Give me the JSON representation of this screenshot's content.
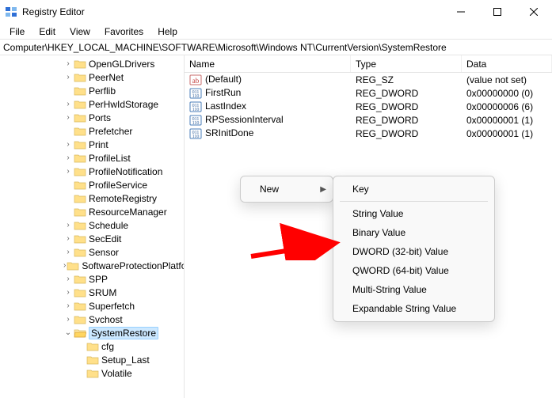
{
  "window": {
    "title": "Registry Editor"
  },
  "menus": {
    "file": "File",
    "edit": "Edit",
    "view": "View",
    "favorites": "Favorites",
    "help": "Help"
  },
  "address": "Computer\\HKEY_LOCAL_MACHINE\\SOFTWARE\\Microsoft\\Windows NT\\CurrentVersion\\SystemRestore",
  "columns": {
    "name": "Name",
    "type": "Type",
    "data": "Data"
  },
  "values": [
    {
      "icon": "string",
      "name": "(Default)",
      "type": "REG_SZ",
      "data": "(value not set)"
    },
    {
      "icon": "binary",
      "name": "FirstRun",
      "type": "REG_DWORD",
      "data": "0x00000000 (0)"
    },
    {
      "icon": "binary",
      "name": "LastIndex",
      "type": "REG_DWORD",
      "data": "0x00000006 (6)"
    },
    {
      "icon": "binary",
      "name": "RPSessionInterval",
      "type": "REG_DWORD",
      "data": "0x00000001 (1)"
    },
    {
      "icon": "binary",
      "name": "SRInitDone",
      "type": "REG_DWORD",
      "data": "0x00000001 (1)"
    }
  ],
  "tree": [
    {
      "indent": 5,
      "exp": ">",
      "label": "OpenGLDrivers"
    },
    {
      "indent": 5,
      "exp": ">",
      "label": "PeerNet"
    },
    {
      "indent": 5,
      "exp": "",
      "label": "Perflib"
    },
    {
      "indent": 5,
      "exp": ">",
      "label": "PerHwIdStorage"
    },
    {
      "indent": 5,
      "exp": ">",
      "label": "Ports"
    },
    {
      "indent": 5,
      "exp": "",
      "label": "Prefetcher"
    },
    {
      "indent": 5,
      "exp": ">",
      "label": "Print"
    },
    {
      "indent": 5,
      "exp": ">",
      "label": "ProfileList"
    },
    {
      "indent": 5,
      "exp": ">",
      "label": "ProfileNotification"
    },
    {
      "indent": 5,
      "exp": "",
      "label": "ProfileService"
    },
    {
      "indent": 5,
      "exp": "",
      "label": "RemoteRegistry"
    },
    {
      "indent": 5,
      "exp": "",
      "label": "ResourceManager"
    },
    {
      "indent": 5,
      "exp": ">",
      "label": "Schedule"
    },
    {
      "indent": 5,
      "exp": ">",
      "label": "SecEdit"
    },
    {
      "indent": 5,
      "exp": ">",
      "label": "Sensor"
    },
    {
      "indent": 5,
      "exp": ">",
      "label": "SoftwareProtectionPlatform"
    },
    {
      "indent": 5,
      "exp": ">",
      "label": "SPP"
    },
    {
      "indent": 5,
      "exp": ">",
      "label": "SRUM"
    },
    {
      "indent": 5,
      "exp": ">",
      "label": "Superfetch"
    },
    {
      "indent": 5,
      "exp": ">",
      "label": "Svchost"
    },
    {
      "indent": 5,
      "exp": "v",
      "label": "SystemRestore",
      "selected": true
    },
    {
      "indent": 6,
      "exp": "",
      "label": "cfg"
    },
    {
      "indent": 6,
      "exp": "",
      "label": "Setup_Last"
    },
    {
      "indent": 6,
      "exp": "",
      "label": "Volatile"
    }
  ],
  "context": {
    "new": "New",
    "sub": [
      "Key",
      "---",
      "String Value",
      "Binary Value",
      "DWORD (32-bit) Value",
      "QWORD (64-bit) Value",
      "Multi-String Value",
      "Expandable String Value"
    ]
  }
}
